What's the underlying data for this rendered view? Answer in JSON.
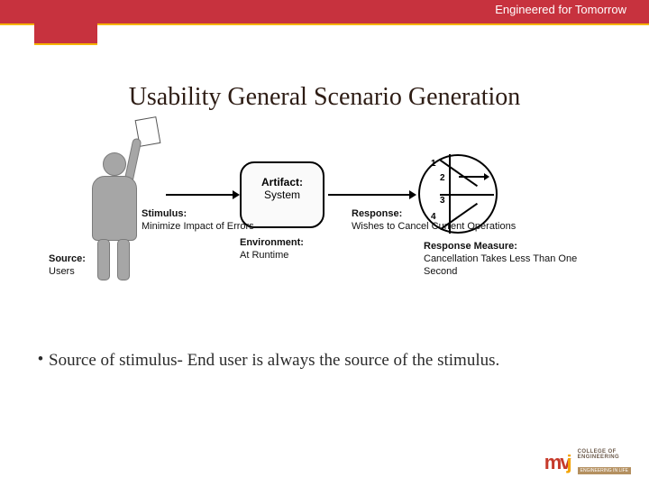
{
  "header": {
    "tagline": "Engineered for Tomorrow"
  },
  "title": "Usability General Scenario Generation",
  "diagram": {
    "artifact_label": "Artifact:",
    "artifact_value": "System",
    "source_label": "Source:",
    "source_value": "Users",
    "stimulus_label": "Stimulus:",
    "stimulus_value": "Minimize Impact of Errors",
    "environment_label": "Environment:",
    "environment_value": "At Runtime",
    "response_label": "Response:",
    "response_value": "Wishes to Cancel Current Operations",
    "measure_label": "Response Measure:",
    "measure_value": "Cancellation Takes Less Than One Second",
    "clock_numbers": {
      "n1": "1",
      "n2": "2",
      "n3": "3",
      "n4": "4"
    }
  },
  "bullet": {
    "text": "Source of stimulus- End user is always the source of the stimulus."
  },
  "logo": {
    "brand_m": "mv",
    "brand_j": "j",
    "line1": "COLLEGE OF",
    "line2": "ENGINEERING",
    "band": "ENGINEERING IN LIFE"
  }
}
